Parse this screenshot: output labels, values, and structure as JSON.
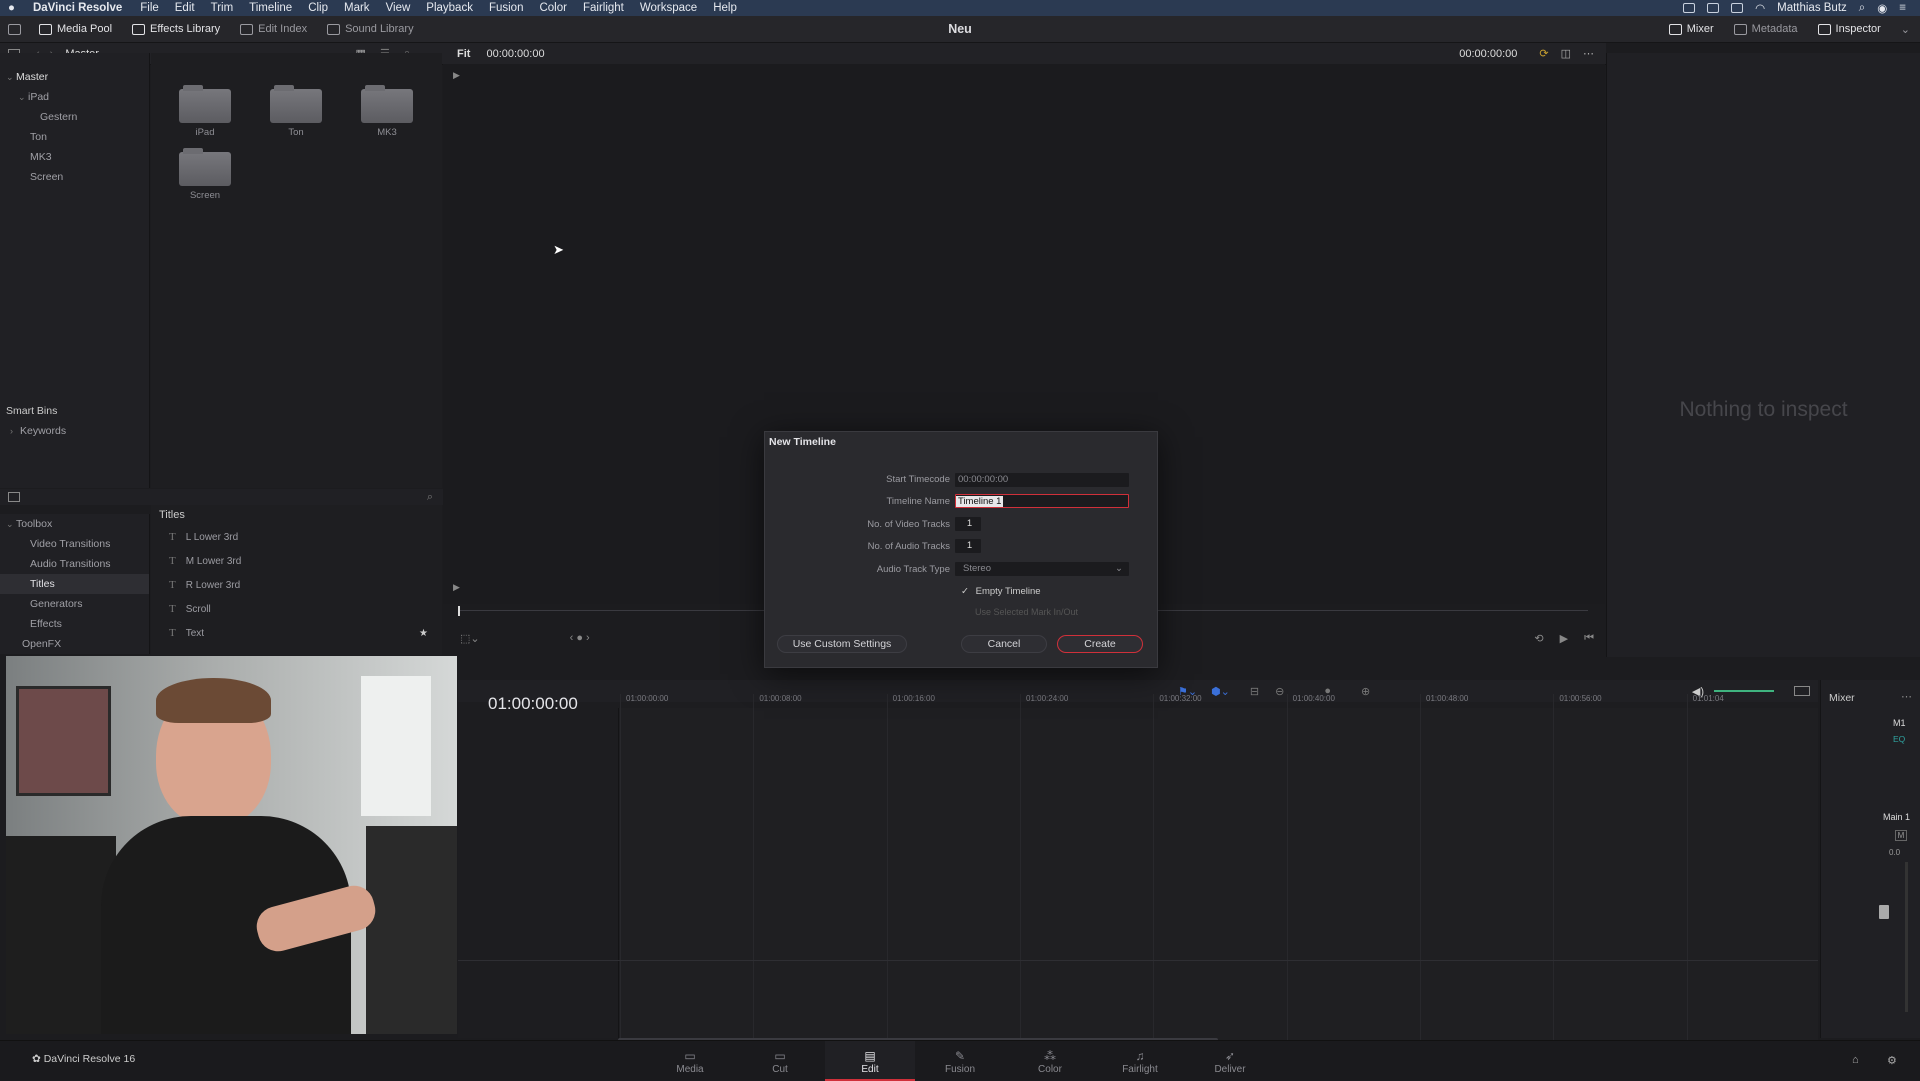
{
  "menubar": {
    "app": "DaVinci Resolve",
    "items": [
      "File",
      "Edit",
      "Trim",
      "Timeline",
      "Clip",
      "Mark",
      "View",
      "Playback",
      "Fusion",
      "Color",
      "Fairlight",
      "Workspace",
      "Help"
    ],
    "user": "Matthias Butz"
  },
  "toolbar": {
    "left": [
      "Media Pool",
      "Effects Library",
      "Edit Index",
      "Sound Library"
    ],
    "right": [
      "Mixer",
      "Metadata",
      "Inspector"
    ],
    "project_title": "Neu"
  },
  "media_pool": {
    "header": "Master",
    "fit": "Fit",
    "source_timecode": "00:00:00:00",
    "record_timecode": "00:00:00:00",
    "bins": [
      "Master",
      "iPad",
      "Gestern",
      "Ton",
      "MK3",
      "Screen"
    ],
    "smart_bins_label": "Smart Bins",
    "smart_bins": [
      "Keywords"
    ],
    "folders": [
      "iPad",
      "Ton",
      "MK3",
      "Screen"
    ]
  },
  "toolbox": {
    "items": [
      "Toolbox",
      "Video Transitions",
      "Audio Transitions",
      "Titles",
      "Generators",
      "Effects",
      "OpenFX"
    ],
    "list_header": "Titles",
    "titles": [
      "L Lower 3rd",
      "M Lower 3rd",
      "R Lower 3rd",
      "Scroll",
      "Text"
    ]
  },
  "inspector": {
    "empty_text": "Nothing to inspect"
  },
  "timeline": {
    "timecode": "01:00:00:00",
    "ruler": [
      "01:00:00:00",
      "01:00:08:00",
      "01:00:16:00",
      "01:00:24:00",
      "01:00:32:00",
      "01:00:40:00",
      "01:00:48:00",
      "01:00:56:00",
      "01:01:04"
    ]
  },
  "mixer": {
    "title": "Mixer",
    "m1": "M1",
    "eq": "EQ",
    "main": "Main 1",
    "m": "M",
    "level": "0.0"
  },
  "dialog": {
    "title": "New Timeline",
    "start_timecode_label": "Start Timecode",
    "start_timecode": "00:00:00:00",
    "timeline_name_label": "Timeline Name",
    "timeline_name": "Timeline 1",
    "video_tracks_label": "No. of Video Tracks",
    "video_tracks": "1",
    "audio_tracks_label": "No. of Audio Tracks",
    "audio_tracks": "1",
    "audio_type_label": "Audio Track Type",
    "audio_type": "Stereo",
    "empty_timeline": "Empty Timeline",
    "use_marks": "Use Selected Mark In/Out",
    "custom_btn": "Use Custom Settings",
    "cancel_btn": "Cancel",
    "create_btn": "Create"
  },
  "pages": [
    "Media",
    "Cut",
    "Edit",
    "Fusion",
    "Color",
    "Fairlight",
    "Deliver"
  ],
  "active_page": "Edit",
  "footer": {
    "version": "DaVinci Resolve 16"
  },
  "colors": {
    "accent": "#d0303a",
    "menubar": "#2b3a52"
  }
}
